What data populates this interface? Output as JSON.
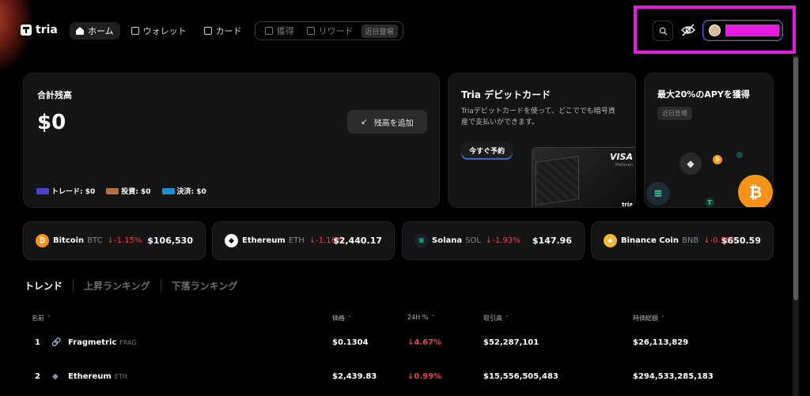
{
  "app": {
    "logo": "tria"
  },
  "nav": {
    "items": [
      {
        "label": "ホーム",
        "icon": "home-icon",
        "active": true
      },
      {
        "label": "ウォレット",
        "icon": "wallet-icon"
      },
      {
        "label": "カード",
        "icon": "card-icon"
      }
    ],
    "group": [
      {
        "label": "獲得",
        "icon": "earn-icon"
      },
      {
        "label": "リワード",
        "icon": "gift-icon"
      }
    ],
    "coming_soon": "近日登場"
  },
  "balance": {
    "title": "合計残高",
    "value": "$0",
    "add_button": "残高を追加",
    "legend": [
      {
        "label": "トレード: $0",
        "color": "#4b3fd0"
      },
      {
        "label": "投資: $0",
        "color": "#b07048"
      },
      {
        "label": "決済: $0",
        "color": "#1e8fd0"
      }
    ]
  },
  "debit": {
    "title": "Tria デビットカード",
    "description": "Triaデビットカードを使って、どこででも暗号資産で支払いができます。",
    "preorder": "今すぐ予約",
    "card_brand": "VISA",
    "card_sub": "Platinum",
    "card_logo": "tria"
  },
  "apy": {
    "title": "最大20%のAPYを獲得",
    "badge": "近日登場"
  },
  "tickers": [
    {
      "name": "Bitcoin",
      "symbol": "BTC",
      "change": "↓-1.15%",
      "price": "$106,530",
      "color": "#f7931a",
      "glyph": "₿"
    },
    {
      "name": "Ethereum",
      "symbol": "ETH",
      "change": "↓-1.16%",
      "price": "$2,440.17",
      "color": "#ffffff",
      "glyph": "◆"
    },
    {
      "name": "Solana",
      "symbol": "SOL",
      "change": "↓-1.93%",
      "price": "$147.96",
      "color": "#14f195",
      "glyph": "≡"
    },
    {
      "name": "Binance Coin",
      "symbol": "BNB",
      "change": "↓-0.58%",
      "price": "$650.59",
      "color": "#f3ba2f",
      "glyph": "◈"
    }
  ],
  "tabs": [
    "トレンド",
    "上昇ランキング",
    "下落ランキング"
  ],
  "table": {
    "headers": [
      "名前",
      "価格",
      "24H %",
      "取引高",
      "時価総額"
    ],
    "rows": [
      {
        "rank": "1",
        "name": "Fragmetric",
        "symbol": "FRAG",
        "price": "$0.1304",
        "change": "↓4.67%",
        "volume": "$52,287,101",
        "mcap": "$26,113,829"
      },
      {
        "rank": "2",
        "name": "Ethereum",
        "symbol": "ETH",
        "price": "$2,439.83",
        "change": "↓0.99%",
        "volume": "$15,556,505,483",
        "mcap": "$294,533,285,183"
      }
    ]
  },
  "colors": {
    "highlight": "#e51be0",
    "negative": "#e0454a"
  }
}
